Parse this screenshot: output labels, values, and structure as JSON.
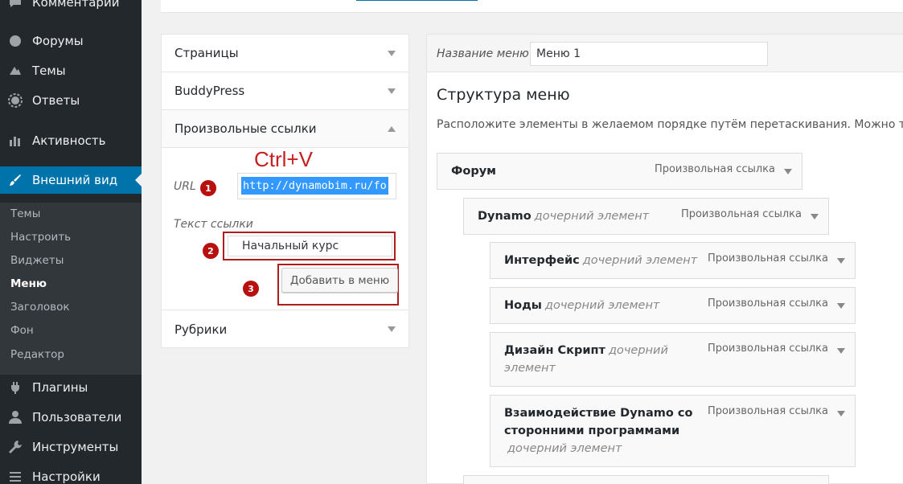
{
  "sidebar": {
    "comments": "Комментарии",
    "forums": "Форумы",
    "themes_top": "Темы",
    "replies": "Ответы",
    "activity": "Активность",
    "appearance": "Внешний вид",
    "submenu": [
      "Темы",
      "Настроить",
      "Виджеты",
      "Меню",
      "Заголовок",
      "Фон",
      "Редактор"
    ],
    "plugins": "Плагины",
    "users": "Пользователи",
    "tools": "Инструменты",
    "settings": "Настройки"
  },
  "accordion": {
    "pages": "Страницы",
    "buddypress": "BuddyPress",
    "custom_links": "Произвольные ссылки",
    "url_label": "URL",
    "url_value": "http://dynamobim.ru/fo",
    "link_text_label": "Текст ссылки",
    "link_text_value": "Начальный курс",
    "add_button": "Добавить в меню",
    "categories": "Рубрики"
  },
  "annotations": {
    "ctrl_v": "Ctrl+V",
    "step1": "1",
    "step2": "2",
    "step3": "3"
  },
  "menu_editor": {
    "name_label": "Название меню",
    "name_value": "Меню 1",
    "structure_title": "Структура меню",
    "structure_desc": "Расположите элементы в желаемом порядке путём перетаскивания. Можно также",
    "sub_item_label": "дочерний элемент",
    "items": [
      {
        "title": "Форум",
        "type": "Произвольная ссылка"
      },
      {
        "title": "Dynamo",
        "type": "Произвольная ссылка"
      },
      {
        "title": "Интерфейс",
        "type": "Произвольная ссылка"
      },
      {
        "title": "Ноды",
        "type": "Произвольная ссылка"
      },
      {
        "title": "Дизайн Скрипт",
        "type": "Произвольная ссылка",
        "sub_line2": "элемент"
      },
      {
        "title_line1": "Взаимодействие Dynamo со",
        "title_line2": "сторонними программами",
        "type": "Произвольная ссылка"
      }
    ]
  },
  "colors": {
    "sidebar_bg": "#23282d",
    "active_blue": "#0073aa",
    "annotation_red": "#b80f0f",
    "selection_blue": "#3399ff"
  }
}
